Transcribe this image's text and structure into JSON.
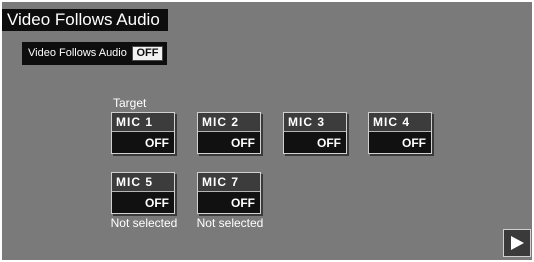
{
  "header": {
    "title": "Video Follows Audio"
  },
  "vfa_setting": {
    "label": "Video Follows Audio",
    "state": "OFF"
  },
  "target": {
    "label": "Target"
  },
  "mics": [
    {
      "label": "MIC 1",
      "state": "OFF"
    },
    {
      "label": "MIC 2",
      "state": "OFF"
    },
    {
      "label": "MIC 3",
      "state": "OFF"
    },
    {
      "label": "MIC 4",
      "state": "OFF"
    },
    {
      "label": "MIC 5",
      "state": "OFF",
      "note": "Not selected"
    },
    {
      "label": "MIC 7",
      "state": "OFF",
      "note": "Not selected"
    }
  ],
  "nav": {
    "next_icon": "play-arrow-icon"
  },
  "colors": {
    "panel": "#7a7a7a",
    "black": "#0d0d0d",
    "text": "#ffffff"
  }
}
